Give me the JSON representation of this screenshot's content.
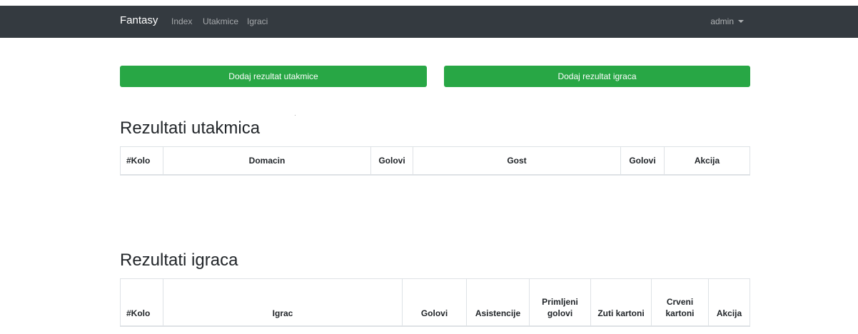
{
  "navbar": {
    "brand": "Fantasy",
    "links": [
      "Index",
      "Utakmice",
      "Igraci"
    ],
    "user": "admin"
  },
  "buttons": {
    "add_match_result": "Dodaj rezultat utakmice",
    "add_player_result": "Dodaj rezultat igraca"
  },
  "match_results": {
    "title": "Rezultati utakmica",
    "columns": [
      "#Kolo",
      "Domacin",
      "Golovi",
      "Gost",
      "Golovi",
      "Akcija"
    ],
    "rows": []
  },
  "player_results": {
    "title": "Rezultati igraca",
    "columns": [
      "#Kolo",
      "Igrac",
      "Golovi",
      "Asistencije",
      "Primljeni golovi",
      "Zuti kartoni",
      "Crveni kartoni",
      "Akcija"
    ],
    "rows": []
  },
  "colors": {
    "navbar": "#343a40",
    "button": "#28a745"
  }
}
